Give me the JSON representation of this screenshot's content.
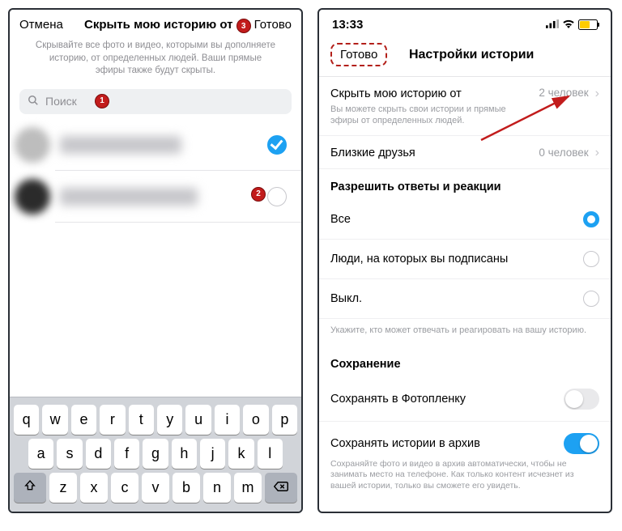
{
  "left": {
    "cancel": "Отмена",
    "title": "Скрыть мою историю от",
    "done": "Готово",
    "description": "Скрывайте все фото и видео, которыми вы дополняете историю, от определенных людей. Ваши прямые эфиры также будут скрыты.",
    "search_placeholder": "Поиск",
    "badges": {
      "b1": "1",
      "b2": "2",
      "b3": "3"
    },
    "keyboard": {
      "r1": [
        "q",
        "w",
        "e",
        "r",
        "t",
        "y",
        "u",
        "i",
        "o",
        "p"
      ],
      "r2": [
        "a",
        "s",
        "d",
        "f",
        "g",
        "h",
        "j",
        "k",
        "l"
      ],
      "r3": [
        "z",
        "x",
        "c",
        "v",
        "b",
        "n",
        "m"
      ]
    }
  },
  "right": {
    "time": "13:33",
    "done": "Готово",
    "title": "Настройки истории",
    "hide_label": "Скрыть мою историю от",
    "hide_sub": "Вы можете скрыть свои истории и прямые эфиры от определенных людей.",
    "hide_value": "2 человек",
    "close_friends": "Близкие друзья",
    "close_friends_value": "0 человек",
    "replies_title": "Разрешить ответы и реакции",
    "opt_all": "Все",
    "opt_following": "Люди, на которых вы подписаны",
    "opt_off": "Выкл.",
    "replies_note": "Укажите, кто может отвечать и реагировать на вашу историю.",
    "save_title": "Сохранение",
    "save_camera": "Сохранять в Фотопленку",
    "save_archive": "Сохранять истории в архив",
    "archive_sub": "Сохраняйте фото и видео в архив автоматически, чтобы не занимать место на телефоне. Как только контент исчезнет из вашей истории, только вы сможете его увидеть."
  }
}
